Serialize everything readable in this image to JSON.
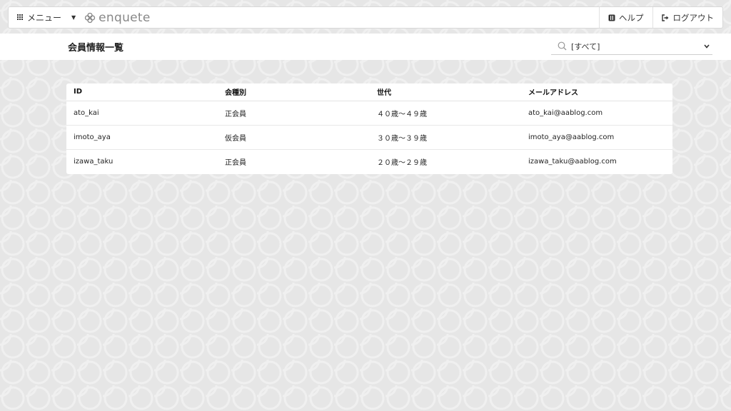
{
  "navbar": {
    "menu_label": "メニュー",
    "brand": "enquete",
    "help_label": "ヘルプ",
    "logout_label": "ログアウト"
  },
  "page": {
    "title": "会員情報一覧",
    "filter_value": "[すべて]"
  },
  "table": {
    "headers": [
      "ID",
      "会種別",
      "世代",
      "メールアドレス"
    ],
    "rows": [
      [
        "ato_kai",
        "正会員",
        "４０歳～４９歳",
        "ato_kai@aablog.com"
      ],
      [
        "imoto_aya",
        "仮会員",
        "３０歳～３９歳",
        "imoto_aya@aablog.com"
      ],
      [
        "izawa_taku",
        "正会員",
        "２０歳～２９歳",
        "izawa_taku@aablog.com"
      ]
    ]
  },
  "icons": {
    "menu": "grid-icon",
    "brand": "clover-icon",
    "help": "book-icon",
    "logout": "sign-out-icon",
    "search": "search-icon",
    "dropdown": "chevron-down-icon"
  }
}
